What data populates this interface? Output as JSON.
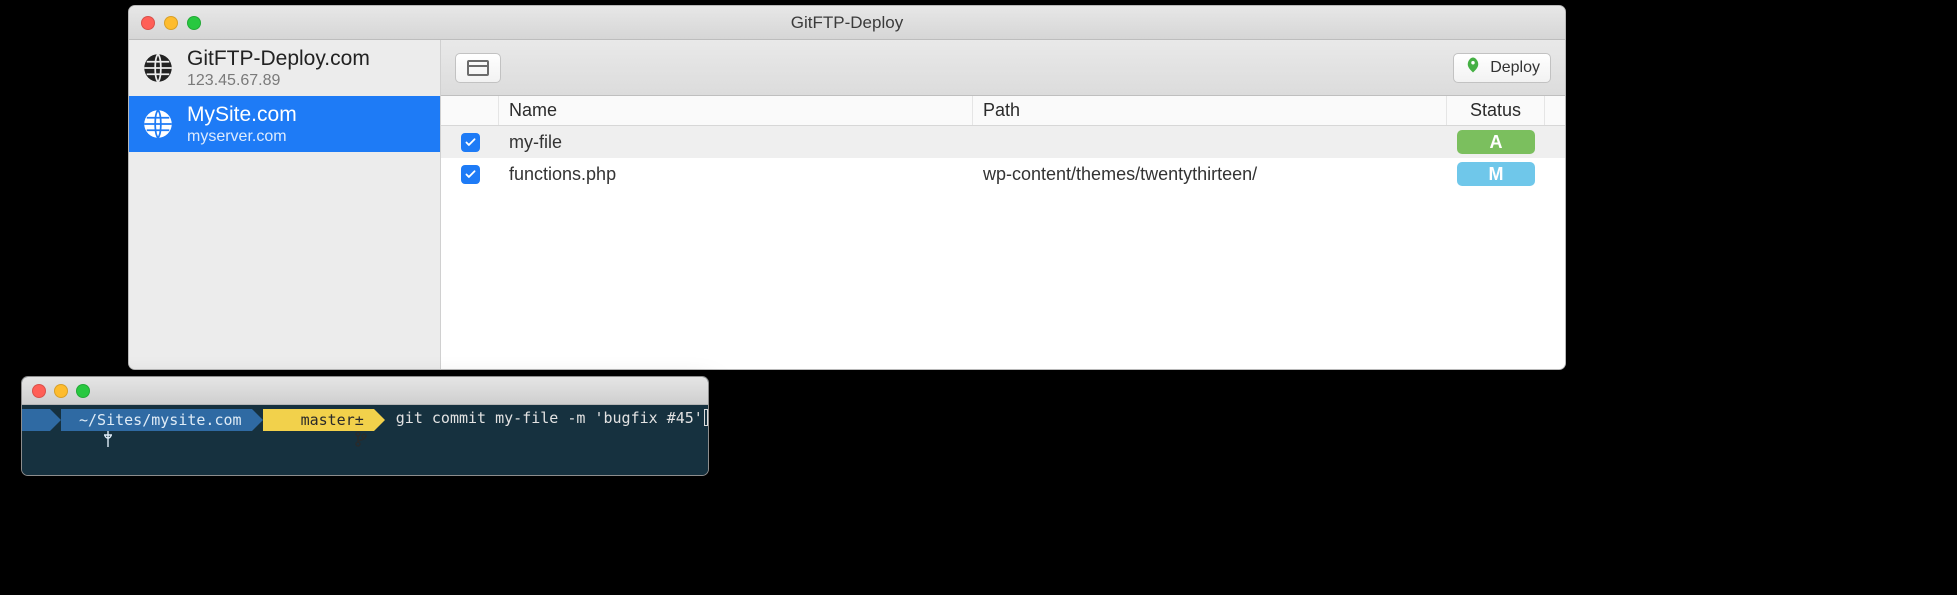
{
  "window": {
    "title": "GitFTP-Deploy"
  },
  "sidebar": {
    "items": [
      {
        "title": "GitFTP-Deploy.com",
        "subtitle": "123.45.67.89",
        "selected": false
      },
      {
        "title": "MySite.com",
        "subtitle": "myserver.com",
        "selected": true
      }
    ]
  },
  "toolbar": {
    "deploy_label": "Deploy"
  },
  "table": {
    "headers": {
      "name": "Name",
      "path": "Path",
      "status": "Status"
    },
    "rows": [
      {
        "checked": true,
        "name": "my-file",
        "path": "",
        "status": "A"
      },
      {
        "checked": true,
        "name": "functions.php",
        "path": "wp-content/themes/twentythirteen/",
        "status": "M"
      }
    ]
  },
  "status_colors": {
    "A": "#7bbf5e",
    "M": "#6fc7ea"
  },
  "accent": "#1e7bf6",
  "terminal": {
    "cwd": "~/Sites/mysite.com",
    "branch": "master±",
    "command": "git commit my-file -m 'bugfix #45'"
  }
}
